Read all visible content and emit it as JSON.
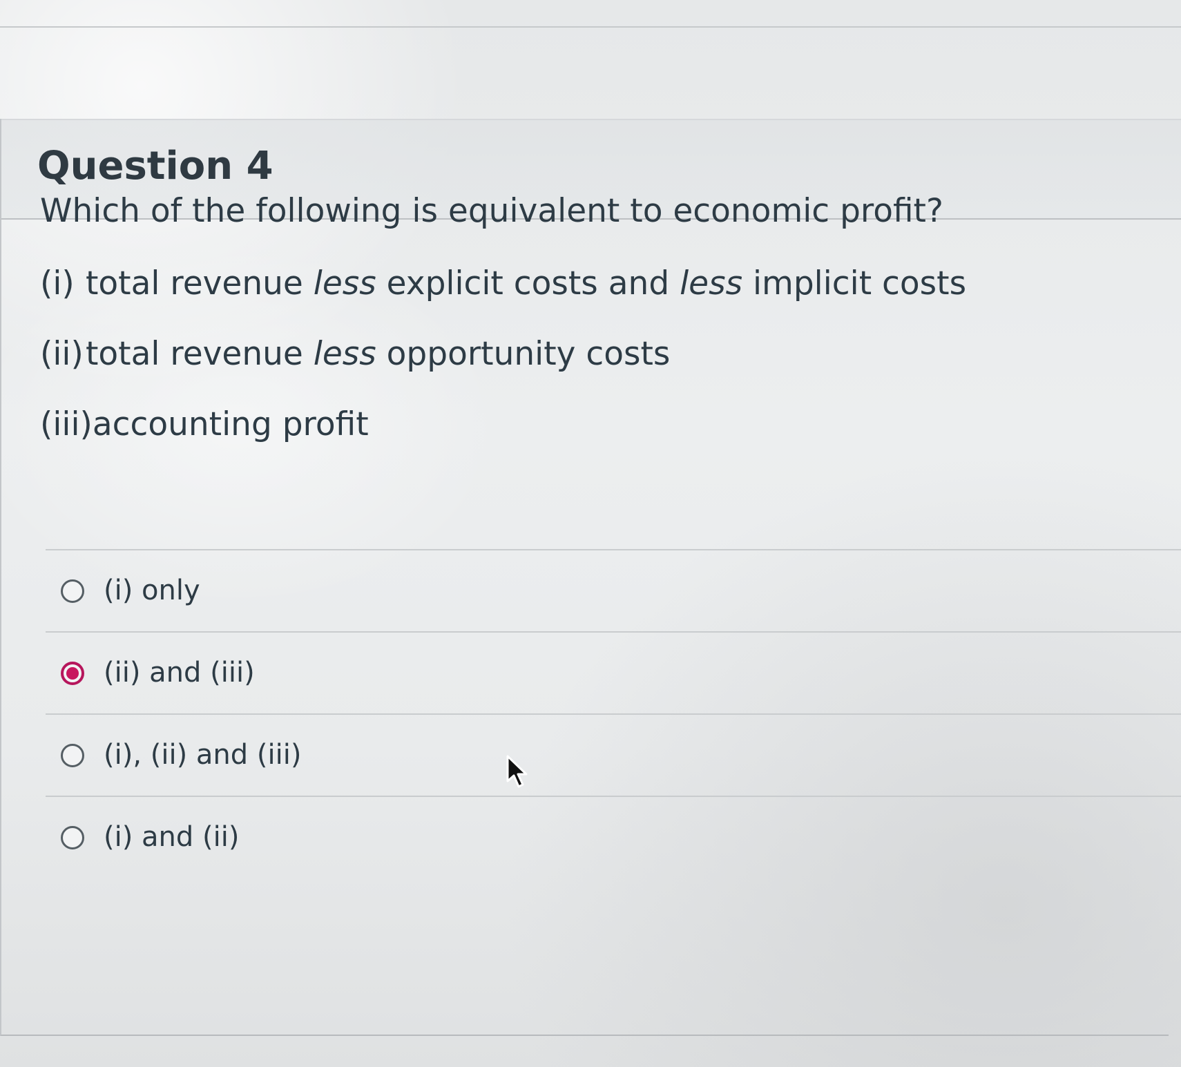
{
  "question": {
    "title": "Question 4",
    "prompt": "Which of the following is equivalent to economic profit?",
    "statements": [
      {
        "number": "(i)",
        "parts": [
          "total revenue ",
          "less",
          " explicit costs and ",
          "less",
          " implicit costs"
        ]
      },
      {
        "number": "(ii)",
        "parts": [
          "total revenue ",
          "less",
          " opportunity costs"
        ]
      },
      {
        "number": "(iii)",
        "parts": [
          "accounting profit"
        ]
      }
    ]
  },
  "answers": [
    {
      "label": "(i) only",
      "selected": false
    },
    {
      "label": "(ii) and (iii)",
      "selected": true
    },
    {
      "label": "(i), (ii) and (iii)",
      "selected": false
    },
    {
      "label": "(i) and (ii)",
      "selected": false
    }
  ],
  "colors": {
    "selected_radio": "#c8175f",
    "text": "#2d3b45",
    "background": "#e9ebec"
  },
  "icons": {
    "cursor": "mouse-pointer-icon"
  }
}
